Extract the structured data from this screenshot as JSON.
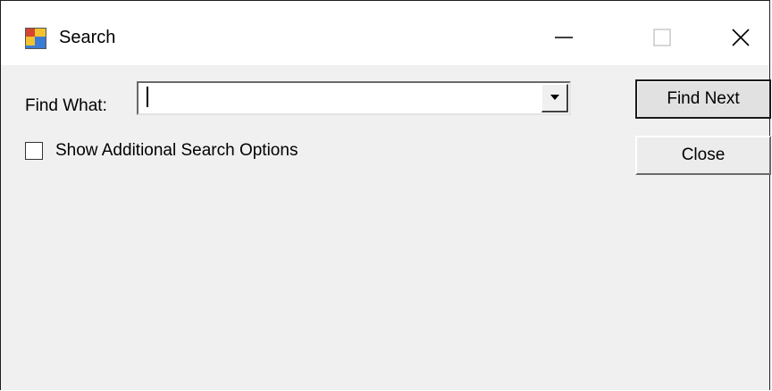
{
  "window": {
    "title": "Search",
    "icon": "app-window-icon",
    "controls": {
      "minimize": "minimize-icon",
      "maximize": "maximize-icon",
      "close": "close-icon"
    }
  },
  "form": {
    "find_what_label": "Find What:",
    "find_what_value": "",
    "find_what_placeholder": "",
    "show_options_label": "Show Additional Search Options",
    "show_options_checked": false
  },
  "buttons": {
    "find_next_label": "Find Next",
    "close_label": "Close"
  },
  "colors": {
    "client_background": "#f0f0f0",
    "titlebar_background": "#ffffff",
    "button_face": "#e1e1e1"
  }
}
